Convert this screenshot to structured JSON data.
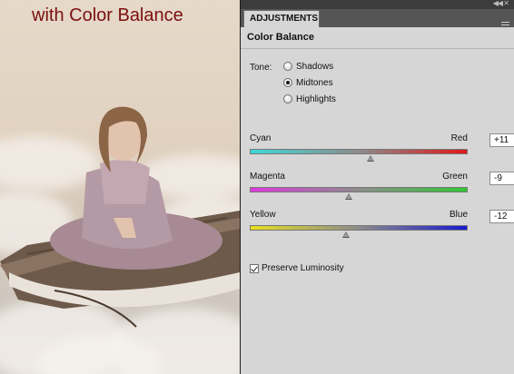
{
  "photo": {
    "caption": "with Color Balance"
  },
  "panel": {
    "tab_label": "ADJUSTMENTS",
    "title": "Color Balance",
    "tone": {
      "label": "Tone:",
      "options": [
        "Shadows",
        "Midtones",
        "Highlights"
      ],
      "selected": "Midtones"
    },
    "sliders": [
      {
        "left": "Cyan",
        "right": "Red",
        "value": "+11",
        "numeric": 11,
        "min": -100,
        "max": 100,
        "gradient_from": "#3fd8d8",
        "gradient_to": "#e01818"
      },
      {
        "left": "Magenta",
        "right": "Green",
        "value": "-9",
        "numeric": -9,
        "min": -100,
        "max": 100,
        "gradient_from": "#e038e0",
        "gradient_to": "#30c830"
      },
      {
        "left": "Yellow",
        "right": "Blue",
        "value": "-12",
        "numeric": -12,
        "min": -100,
        "max": 100,
        "gradient_from": "#e8e020",
        "gradient_to": "#1818d0"
      }
    ],
    "preserve_luminosity": {
      "label": "Preserve Luminosity",
      "checked": true
    }
  },
  "icons": [
    "collapse-icon",
    "panel-menu-icon"
  ]
}
